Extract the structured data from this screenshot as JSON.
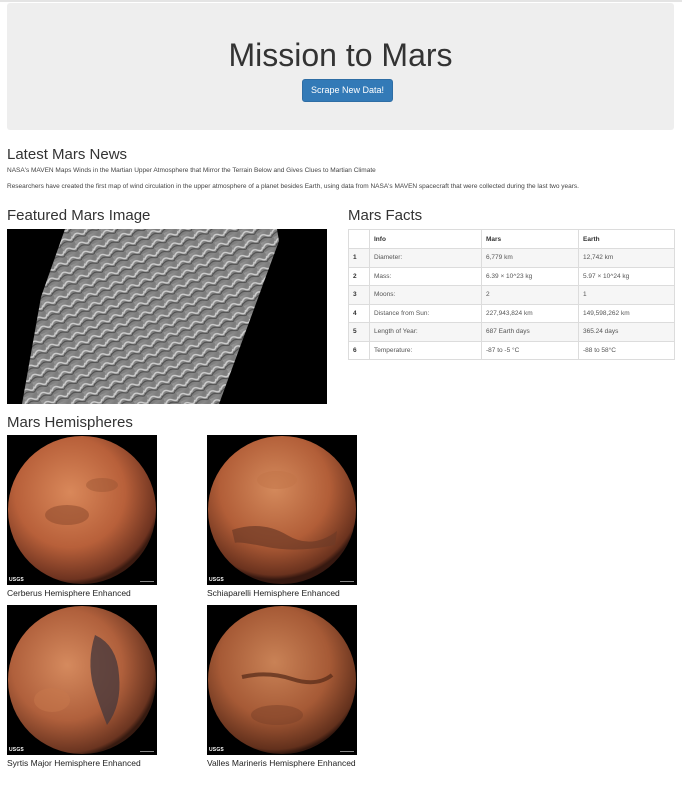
{
  "header": {
    "title": "Mission to Mars",
    "scrape_button": "Scrape New Data!"
  },
  "news": {
    "heading": "Latest Mars News",
    "title": "NASA's MAVEN Maps Winds in the Martian Upper Atmosphere that Mirror the Terrain Below and Gives Clues to Martian Climate",
    "paragraph": "Researchers have created the first map of wind circulation in the upper atmosphere of a planet besides Earth, using data from NASA's MAVEN spacecraft that were collected during the last two years."
  },
  "featured": {
    "heading": "Featured Mars Image"
  },
  "facts": {
    "heading": "Mars Facts",
    "columns": [
      "",
      "Info",
      "Mars",
      "Earth"
    ],
    "rows": [
      {
        "idx": "1",
        "info": "Diameter:",
        "mars": "6,779 km",
        "earth": "12,742 km"
      },
      {
        "idx": "2",
        "info": "Mass:",
        "mars": "6.39 × 10^23 kg",
        "earth": "5.97 × 10^24 kg"
      },
      {
        "idx": "3",
        "info": "Moons:",
        "mars": "2",
        "earth": "1"
      },
      {
        "idx": "4",
        "info": "Distance from Sun:",
        "mars": "227,943,824 km",
        "earth": "149,598,262 km"
      },
      {
        "idx": "5",
        "info": "Length of Year:",
        "mars": "687 Earth days",
        "earth": "365.24 days"
      },
      {
        "idx": "6",
        "info": "Temperature:",
        "mars": "-87 to -5 °C",
        "earth": "-88 to 58°C"
      }
    ]
  },
  "hemispheres": {
    "heading": "Mars Hemispheres",
    "items": [
      {
        "title": "Cerberus Hemisphere Enhanced",
        "logo": "USGS"
      },
      {
        "title": "Schiaparelli Hemisphere Enhanced",
        "logo": "USGS"
      },
      {
        "title": "Syrtis Major Hemisphere Enhanced",
        "logo": "USGS"
      },
      {
        "title": "Valles Marineris Hemisphere Enhanced",
        "logo": "USGS"
      }
    ]
  },
  "colors": {
    "button": "#337ab7",
    "jumbotron": "#eeeeee"
  }
}
